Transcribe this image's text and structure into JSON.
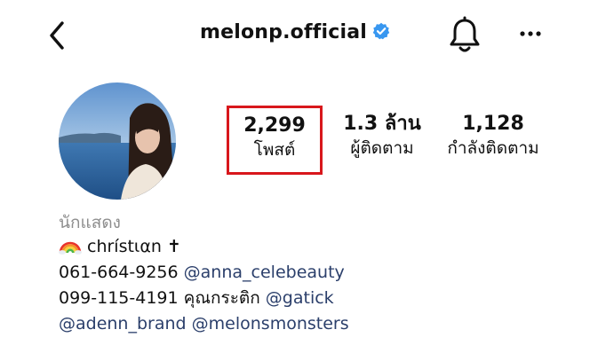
{
  "header": {
    "username": "melonp.official"
  },
  "stats": {
    "posts_count": "2,299",
    "posts_label": "โพสต์",
    "followers_count": "1.3 ล้าน",
    "followers_label": "ผู้ติดตาม",
    "following_count": "1,128",
    "following_label": "กำลังติดตาม"
  },
  "bio": {
    "category": "นักแสดง",
    "name_line": "chrístιαn ✝",
    "phone1": "061-664-9256",
    "handle1": "@anna_celebeauty",
    "phone2": "099-115-4191",
    "contact2": "คุณกระติก",
    "handle2": "@gatick",
    "handle3": "@adenn_brand",
    "handle4": "@melonsmonsters"
  },
  "colors": {
    "highlight_border": "#d8171c",
    "verified_badge": "#3897f0",
    "link": "#2b3f6b",
    "category_text": "#8e8e8e"
  },
  "icons": [
    "back-chevron-icon",
    "verified-badge-icon",
    "bell-icon",
    "more-dots-icon",
    "rainbow-emoji-icon"
  ]
}
